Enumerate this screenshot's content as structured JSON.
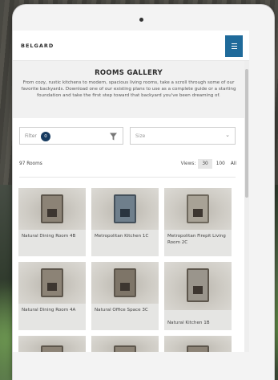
{
  "header": {
    "logo": "BELGARD"
  },
  "gallery": {
    "title": "ROOMS GALLERY",
    "description": "From cozy, rustic kitchens to modern, spacious living rooms, take a scroll through some of our favorite backyards. Download one of our existing plans to use as a complete guide or a starting foundation and take the first step toward that backyard you've been dreaming of."
  },
  "filters": {
    "filter_label": "Filter",
    "filter_count": "0",
    "size_placeholder": "Size"
  },
  "results": {
    "count_label": "97 Rooms",
    "views_label": "Views:",
    "view_options": [
      "30",
      "100",
      "All"
    ],
    "active_view": "30"
  },
  "rooms": [
    {
      "name": "Natural Dining Room 4B"
    },
    {
      "name": "Metropolitan Kitchen 1C"
    },
    {
      "name": "Metropolitan Firepit Living Room 2C"
    },
    {
      "name": "Natural Dining Room 4A"
    },
    {
      "name": "Natural Office Space 3C"
    },
    {
      "name": "Natural Kitchen 1B"
    }
  ],
  "colors": {
    "accent": "#1f6a9a",
    "badge": "#163a5f"
  }
}
